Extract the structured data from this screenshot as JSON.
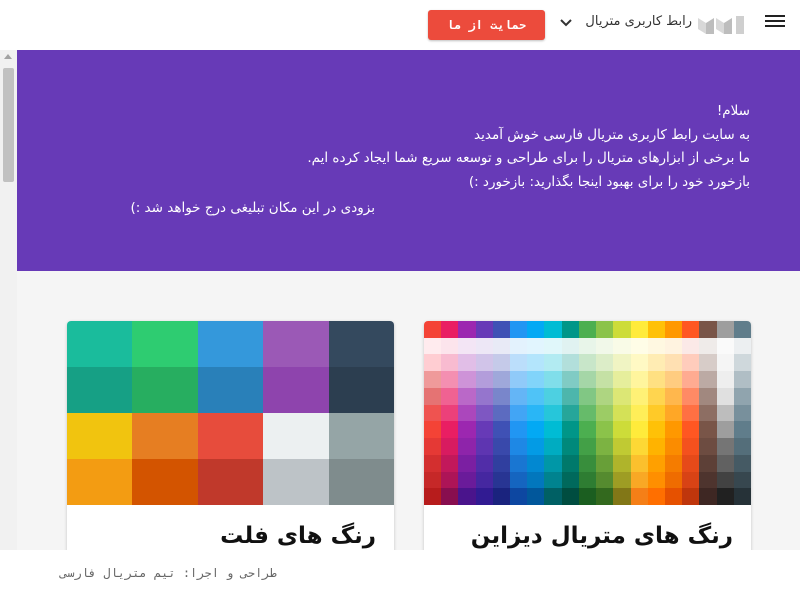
{
  "header": {
    "brand_title": "رابط کاربری متریال",
    "support_button": "حمایت از ما"
  },
  "hero": {
    "lines": [
      "سلام!",
      "به سایت رابط کاربری متریال فارسی خوش آمدید",
      "ما برخی از ابزارهای متریال را برای طراحی و توسعه سریع شما ایجاد کرده ایم.",
      "بازخورد خود را برای بهبود اینجا بگذارید: بازخورد :)"
    ],
    "ad_text": "بزودی در این مکان تبلیغی درج خواهد شد :)"
  },
  "cards": {
    "flat": {
      "title": "رنگ های فلت",
      "colors": [
        [
          "#1abc9c",
          "#2ecc71",
          "#3498db",
          "#9b59b6",
          "#34495e"
        ],
        [
          "#16a085",
          "#27ae60",
          "#2980b9",
          "#8e44ad",
          "#2c3e50"
        ],
        [
          "#f1c40f",
          "#e67e22",
          "#e74c3c",
          "#ecf0f1",
          "#95a5a6"
        ],
        [
          "#f39c12",
          "#d35400",
          "#c0392b",
          "#bdc3c7",
          "#7f8c8d"
        ]
      ]
    },
    "material": {
      "title": "رنگ های متریال دیزاین",
      "colors": [
        [
          "#f44336",
          "#e91e63",
          "#9c27b0",
          "#673ab7",
          "#3f51b5",
          "#2196f3",
          "#03a9f4",
          "#00bcd4",
          "#009688",
          "#4caf50",
          "#8bc34a",
          "#cddc39",
          "#ffeb3b",
          "#ffc107",
          "#ff9800",
          "#ff5722",
          "#795548",
          "#9e9e9e",
          "#607d8b"
        ],
        [
          "#ffebee",
          "#fce4ec",
          "#f3e5f5",
          "#ede7f6",
          "#e8eaf6",
          "#e3f2fd",
          "#e1f5fe",
          "#e0f7fa",
          "#e0f2f1",
          "#e8f5e9",
          "#f1f8e9",
          "#f9fbe7",
          "#fffde7",
          "#fff8e1",
          "#fff3e0",
          "#fbe9e7",
          "#efebe9",
          "#fafafa",
          "#eceff1"
        ],
        [
          "#ffcdd2",
          "#f8bbd0",
          "#e1bee7",
          "#d1c4e9",
          "#c5cae9",
          "#bbdefb",
          "#b3e5fc",
          "#b2ebf2",
          "#b2dfdb",
          "#c8e6c9",
          "#dcedc8",
          "#f0f4c3",
          "#fff9c4",
          "#ffecb3",
          "#ffe0b2",
          "#ffccbc",
          "#d7ccc8",
          "#f5f5f5",
          "#cfd8dc"
        ],
        [
          "#ef9a9a",
          "#f48fb1",
          "#ce93d8",
          "#b39ddb",
          "#9fa8da",
          "#90caf9",
          "#81d4fa",
          "#80deea",
          "#80cbc4",
          "#a5d6a7",
          "#c5e1a5",
          "#e6ee9c",
          "#fff59d",
          "#ffe082",
          "#ffcc80",
          "#ffab91",
          "#bcaaa4",
          "#eeeeee",
          "#b0bec5"
        ],
        [
          "#e57373",
          "#f06292",
          "#ba68c8",
          "#9575cd",
          "#7986cb",
          "#64b5f6",
          "#4fc3f7",
          "#4dd0e1",
          "#4db6ac",
          "#81c784",
          "#aed581",
          "#dce775",
          "#fff176",
          "#ffd54f",
          "#ffb74d",
          "#ff8a65",
          "#a1887f",
          "#e0e0e0",
          "#90a4ae"
        ],
        [
          "#ef5350",
          "#ec407a",
          "#ab47bc",
          "#7e57c2",
          "#5c6bc0",
          "#42a5f5",
          "#29b6f6",
          "#26c6da",
          "#26a69a",
          "#66bb6a",
          "#9ccc65",
          "#d4e157",
          "#ffee58",
          "#ffca28",
          "#ffa726",
          "#ff7043",
          "#8d6e63",
          "#bdbdbd",
          "#78909c"
        ],
        [
          "#f44336",
          "#e91e63",
          "#9c27b0",
          "#673ab7",
          "#3f51b5",
          "#2196f3",
          "#03a9f4",
          "#00bcd4",
          "#009688",
          "#4caf50",
          "#8bc34a",
          "#cddc39",
          "#ffeb3b",
          "#ffc107",
          "#ff9800",
          "#ff5722",
          "#795548",
          "#9e9e9e",
          "#607d8b"
        ],
        [
          "#e53935",
          "#d81b60",
          "#8e24aa",
          "#5e35b1",
          "#3949ab",
          "#1e88e5",
          "#039be5",
          "#00acc1",
          "#00897b",
          "#43a047",
          "#7cb342",
          "#c0ca33",
          "#fdd835",
          "#ffb300",
          "#fb8c00",
          "#f4511e",
          "#6d4c41",
          "#757575",
          "#546e7a"
        ],
        [
          "#d32f2f",
          "#c2185b",
          "#7b1fa2",
          "#512da8",
          "#303f9f",
          "#1976d2",
          "#0288d1",
          "#0097a7",
          "#00796b",
          "#388e3c",
          "#689f38",
          "#afb42b",
          "#fbc02d",
          "#ffa000",
          "#f57c00",
          "#e64a19",
          "#5d4037",
          "#616161",
          "#455a64"
        ],
        [
          "#c62828",
          "#ad1457",
          "#6a1b9a",
          "#4527a0",
          "#283593",
          "#1565c0",
          "#0277bd",
          "#00838f",
          "#00695c",
          "#2e7d32",
          "#558b2f",
          "#9e9d24",
          "#f9a825",
          "#ff8f00",
          "#ef6c00",
          "#d84315",
          "#4e342e",
          "#424242",
          "#37474f"
        ],
        [
          "#b71c1c",
          "#880e4f",
          "#4a148c",
          "#311b92",
          "#1a237e",
          "#0d47a1",
          "#01579b",
          "#006064",
          "#004d40",
          "#1b5e20",
          "#33691e",
          "#827717",
          "#f57f17",
          "#ff6f00",
          "#e65100",
          "#bf360c",
          "#3e2723",
          "#212121",
          "#263238"
        ]
      ]
    }
  },
  "footer": {
    "credit": "طراحی و اجرا: تیم متریال فارسی"
  }
}
